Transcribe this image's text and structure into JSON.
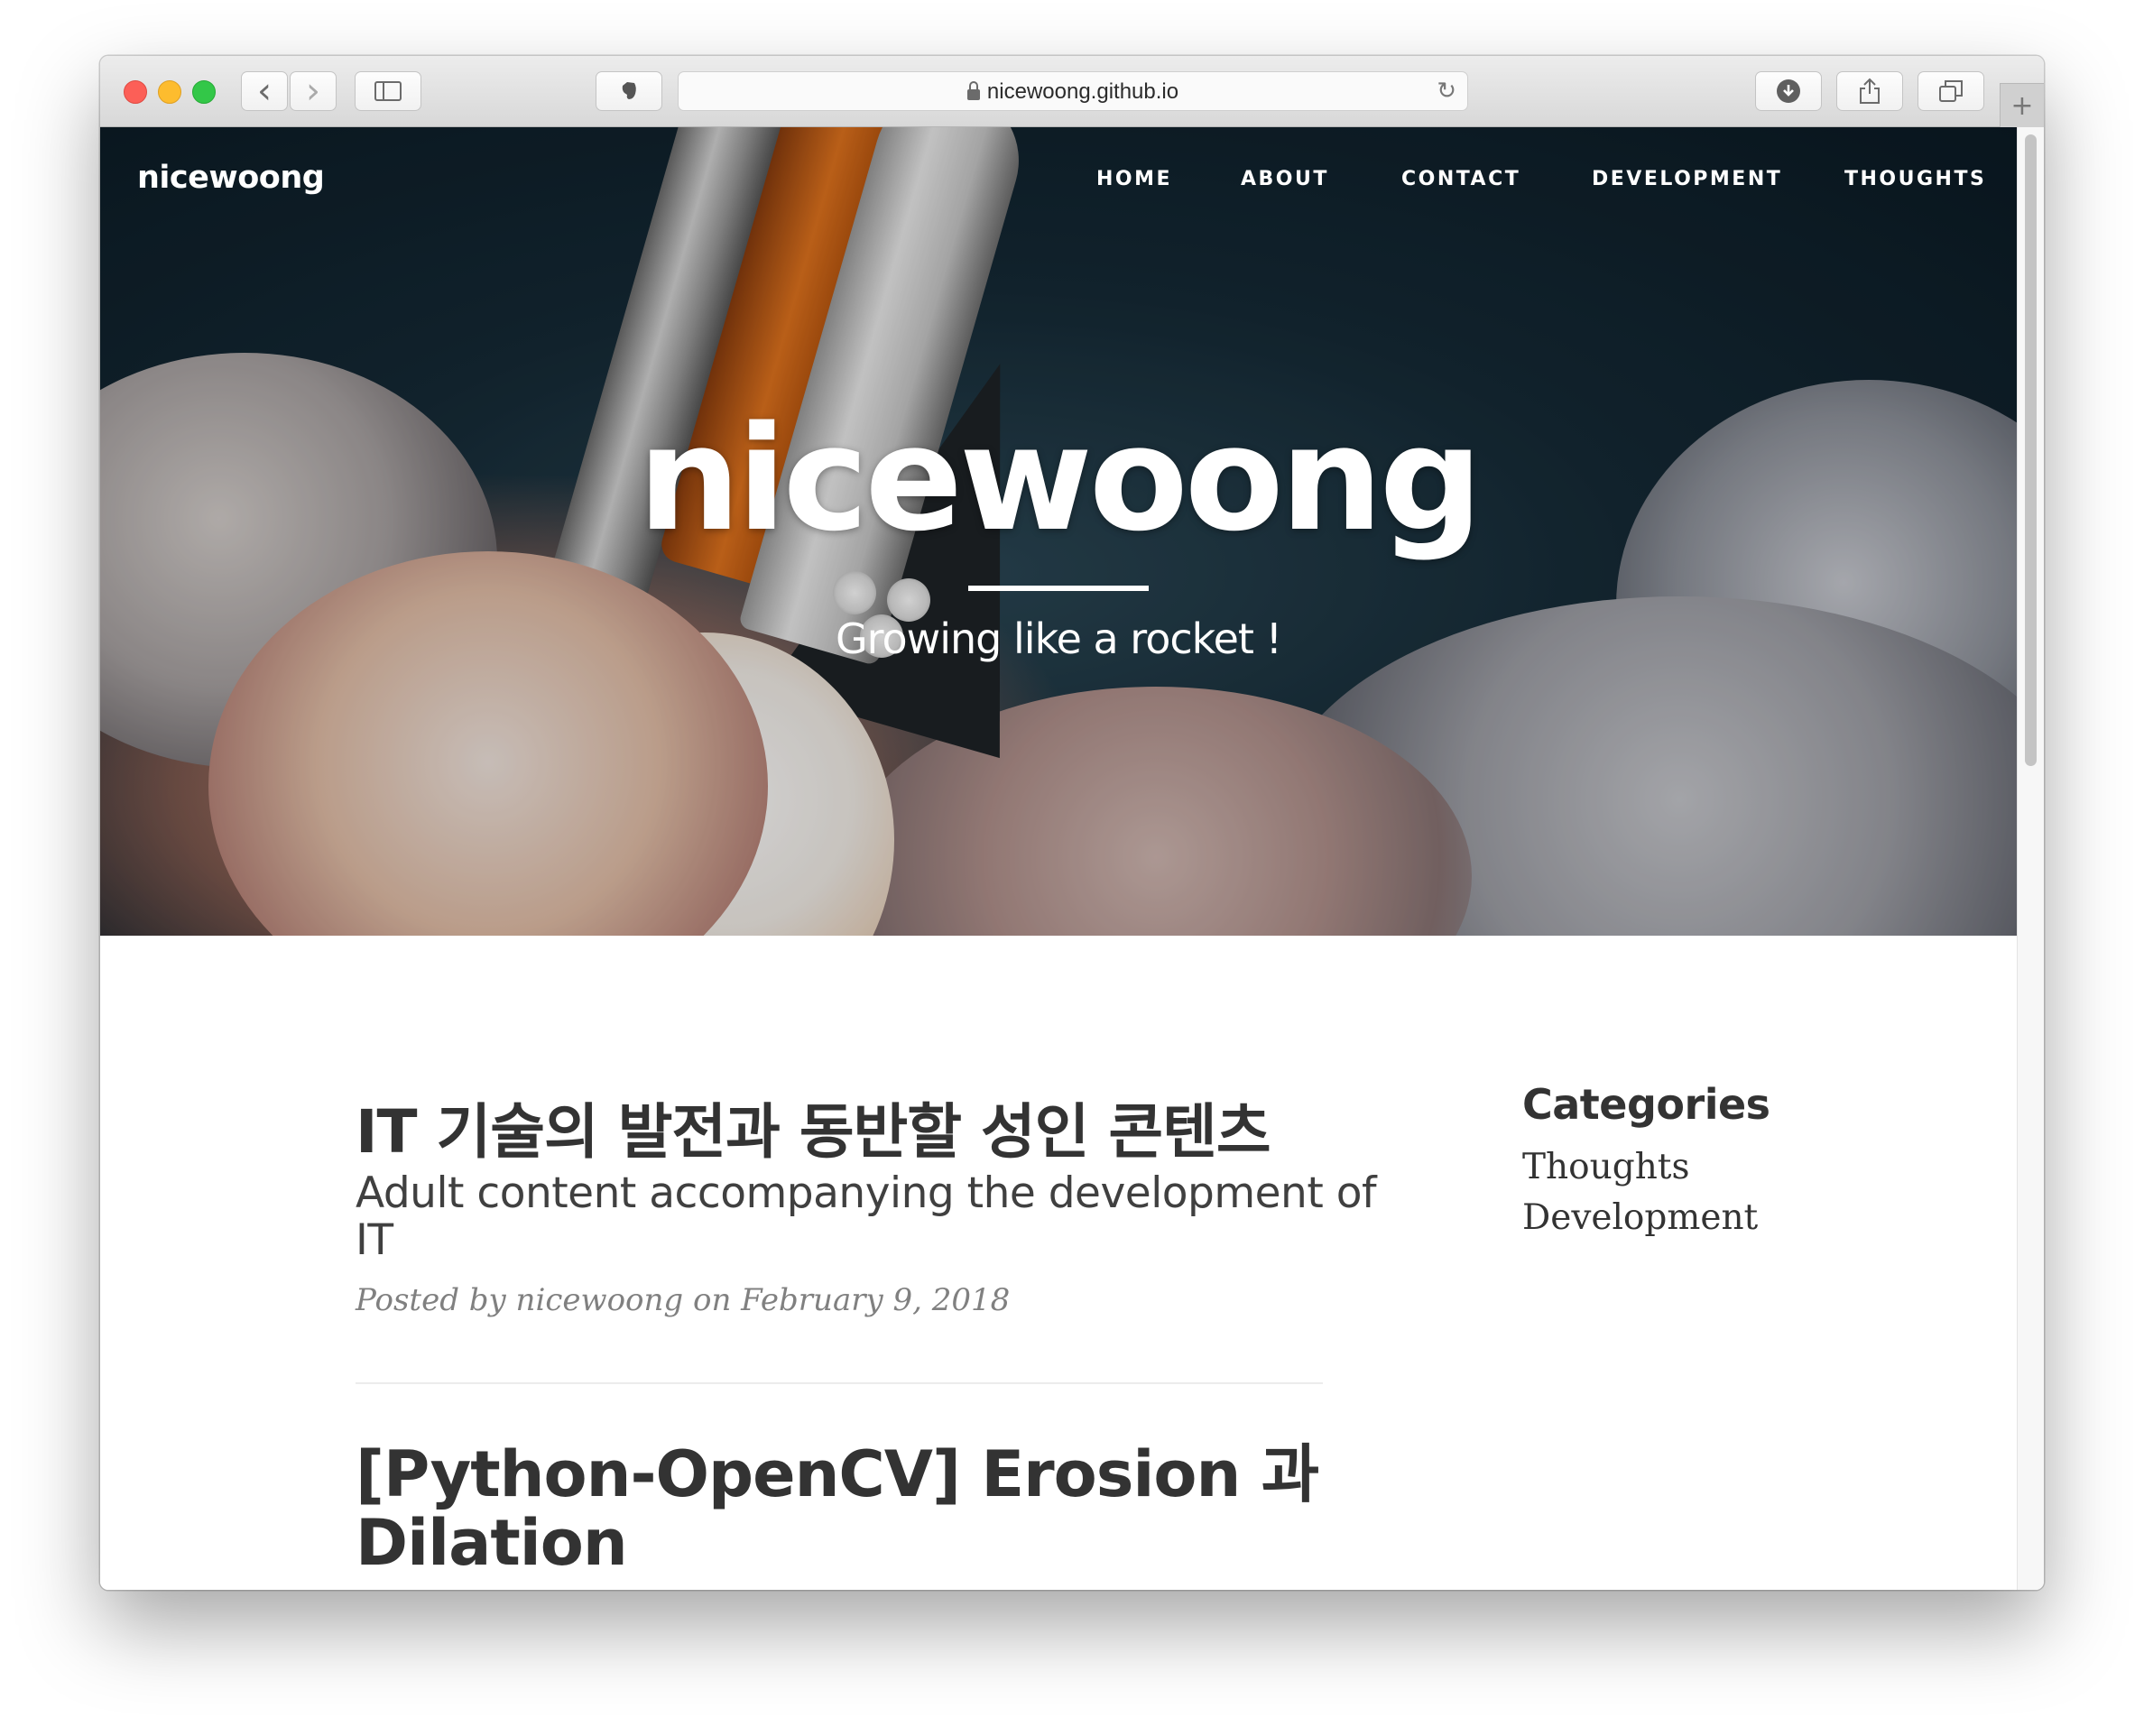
{
  "browser": {
    "url": "nicewoong.github.io",
    "back_icon": "‹",
    "forward_icon": "›",
    "new_tab_icon": "+"
  },
  "site": {
    "brand": "nicewoong",
    "nav": [
      {
        "label": "HOME"
      },
      {
        "label": "ABOUT"
      },
      {
        "label": "CONTACT"
      },
      {
        "label": "DEVELOPMENT"
      },
      {
        "label": "THOUGHTS"
      }
    ]
  },
  "hero": {
    "title": "nicewoong",
    "subtitle": "Growing like a rocket !"
  },
  "posts": [
    {
      "title": "IT 기술의 발전과 동반할 성인 콘텐츠",
      "subtitle_line1": "Adult content accompanying the development of",
      "subtitle_line2": "IT",
      "meta": "Posted by nicewoong on February 9, 2018"
    },
    {
      "title_line1": "[Python-OpenCV] Erosion 과",
      "title_line2": "Dilation"
    }
  ],
  "sidebar": {
    "heading": "Categories",
    "links": [
      {
        "label": "Thoughts"
      },
      {
        "label": "Development"
      }
    ]
  },
  "colors": {
    "hero_dark": "#152a36",
    "text_dark": "#333333",
    "meta_gray": "#808080"
  }
}
